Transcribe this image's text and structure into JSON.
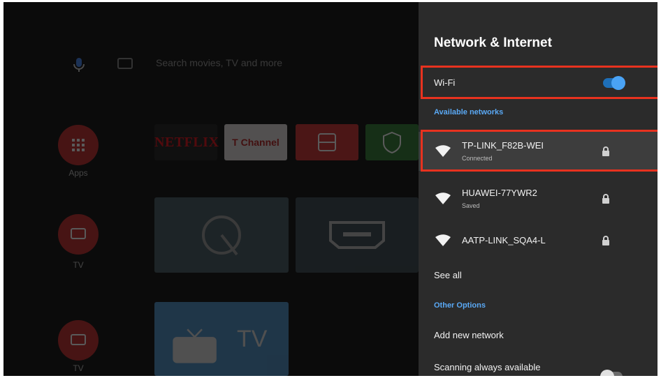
{
  "launcher": {
    "search_placeholder": "Search movies, TV and more",
    "side_items": [
      {
        "label": "Apps",
        "icon": "apps-grid-icon"
      },
      {
        "label": "TV",
        "icon": "tv-icon"
      },
      {
        "label": "TV",
        "icon": "tv-icon"
      }
    ],
    "app_tiles": [
      {
        "label": "NETFLIX",
        "icon": "netflix-logo"
      },
      {
        "label": "T Channel",
        "icon": "t-channel-logo"
      },
      {
        "label": "",
        "icon": "app-store-icon"
      },
      {
        "label": "",
        "icon": "security-shield-icon"
      }
    ],
    "card_text": "TV"
  },
  "panel": {
    "title": "Network & Internet",
    "wifi": {
      "label": "Wi-Fi",
      "enabled": true
    },
    "available_networks_label": "Available networks",
    "networks": [
      {
        "name": "TP-LINK_F82B-WEI",
        "status": "Connected",
        "locked": true,
        "icon": "wifi-icon",
        "selected": true
      },
      {
        "name": "HUAWEI-77YWR2",
        "status": "Saved",
        "locked": true,
        "icon": "wifi-icon"
      },
      {
        "name": "AATP-LINK_SQA4-L",
        "status": "",
        "locked": true,
        "icon": "wifi-icon"
      }
    ],
    "see_all": "See all",
    "other_options_label": "Other Options",
    "add_new_network": "Add new network",
    "scanning_label": "Scanning always available",
    "scanning_enabled": false
  },
  "colors": {
    "accent": "#4aa3f5",
    "highlight_border": "#e8321f",
    "panel_bg": "#2b2b2b",
    "selected_row_bg": "#3d3d3d"
  }
}
